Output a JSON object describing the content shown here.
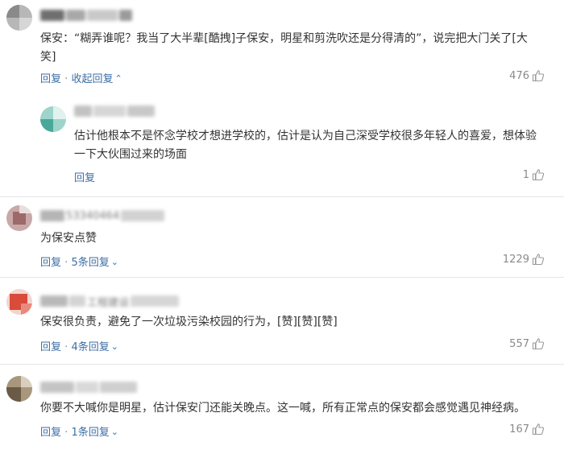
{
  "comments": [
    {
      "text_line1": "保安：“糊弄谁呢？我当了大半辈[酷拽]子保安，明星和剪洗吹还是分得清的”，说完把大门关了[大",
      "text_line2": "笑]",
      "reply_label": "回复",
      "sep": "·",
      "collapse_label": "收起回复",
      "likes": "476",
      "avatar_colors": [
        "#8a8a8a",
        "#b7b7b7",
        "#d6d6d6"
      ],
      "reply": {
        "text_line1": "估计他根本不是怀念学校才想进学校的，估计是认为自己深受学校很多年轻人的喜爱，想体验",
        "text_line2": "一下大伙围过来的场面",
        "reply_label": "回复",
        "likes": "1",
        "avatar_colors": [
          "#4aa89a",
          "#9fd4cb",
          "#e0f1ee"
        ]
      }
    },
    {
      "user_partial": "53340464",
      "text": "为保安点赞",
      "reply_label": "回复",
      "sep": "·",
      "more_replies": "5条回复",
      "likes": "1229",
      "avatar_colors": [
        "#9c6a6a",
        "#c9a8a8",
        "#e9dede"
      ]
    },
    {
      "user_partial": "工程建设",
      "text": "保安很负责，避免了一次垃圾污染校园的行为，[赞][赞][赞]",
      "reply_label": "回复",
      "sep": "·",
      "more_replies": "4条回复",
      "likes": "557",
      "avatar_colors": [
        "#d94b3a",
        "#e88a7d",
        "#f3d5cf"
      ]
    },
    {
      "text": "你要不大喊你是明星，估计保安门还能关晚点。这一喊，所有正常点的保安都会感觉遇见神经病。",
      "reply_label": "回复",
      "sep": "·",
      "more_replies": "1条回复",
      "likes": "167",
      "avatar_colors": [
        "#6b5a45",
        "#a8977c",
        "#d9cfbf"
      ]
    }
  ],
  "colors": {
    "link": "#3d6ea5",
    "text": "#333333",
    "muted": "#8a8a8a",
    "divider": "#e6e6e6"
  },
  "icons": {
    "like": "thumbs-up-icon",
    "chevron_up": "chevron-up-icon",
    "chevron_down": "chevron-down-icon"
  }
}
